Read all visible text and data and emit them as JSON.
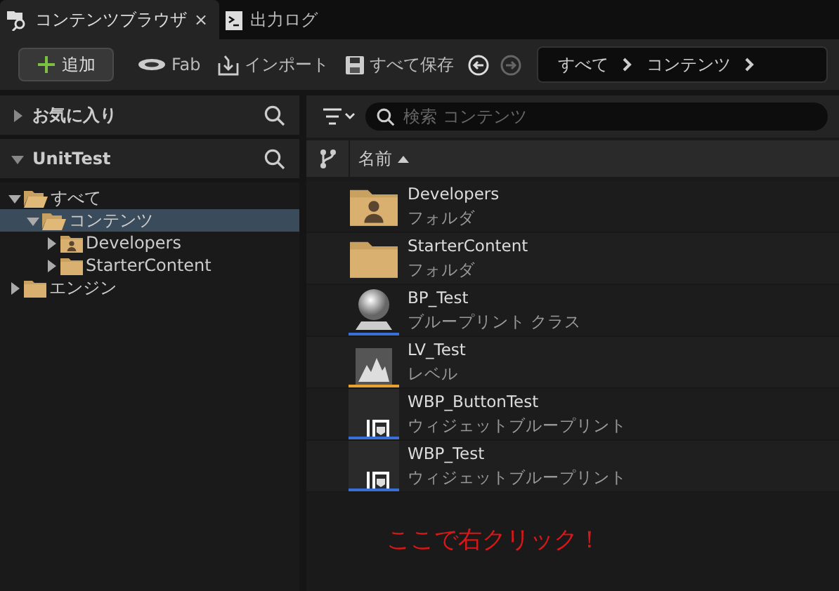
{
  "tabs": [
    {
      "label": "コンテンツブラウザ",
      "close": "×",
      "selected": true
    },
    {
      "label": "出力ログ",
      "selected": false
    }
  ],
  "toolbar": {
    "add": "追加",
    "buttons": [
      {
        "label": "Fab"
      },
      {
        "label": "インポート"
      },
      {
        "label": "すべて保存"
      }
    ],
    "nav": [
      {
        "disabled": false
      },
      {
        "disabled": true
      }
    ],
    "breadcrumbs": [
      "すべて",
      "コンテンツ"
    ]
  },
  "sidebar": {
    "sections": [
      {
        "title": "お気に入り",
        "expanded": false
      },
      {
        "title": "UnitTest",
        "expanded": true
      }
    ],
    "tree": [
      {
        "label": "すべて",
        "expanded": true,
        "selected": false,
        "kind": "folder",
        "children": [
          {
            "label": "コンテンツ",
            "expanded": true,
            "selected": true,
            "kind": "folder",
            "children": [
              {
                "label": "Developers",
                "expanded": false,
                "selected": false,
                "kind": "user-folder"
              },
              {
                "label": "StarterContent",
                "expanded": false,
                "selected": false,
                "kind": "folder"
              }
            ]
          }
        ]
      },
      {
        "label": "エンジン",
        "expanded": false,
        "selected": false,
        "kind": "folder"
      }
    ]
  },
  "search": {
    "placeholder": "検索 コンテンツ"
  },
  "columns": [
    {
      "label": "名前",
      "sorted": true
    }
  ],
  "assets": [
    {
      "name": "Developers",
      "type": "フォルダ",
      "kind": "user-folder"
    },
    {
      "name": "StarterContent",
      "type": "フォルダ",
      "kind": "folder"
    },
    {
      "name": "BP_Test",
      "type": "ブループリント クラス",
      "kind": "blueprint",
      "color": "#3a6fd8"
    },
    {
      "name": "LV_Test",
      "type": "レベル",
      "kind": "level",
      "color": "#e8a030"
    },
    {
      "name": "WBP_ButtonTest",
      "type": "ウィジェットブループリント",
      "kind": "widget",
      "color": "#3a6fd8"
    },
    {
      "name": "WBP_Test",
      "type": "ウィジェットブループリント",
      "kind": "widget",
      "color": "#3a6fd8"
    }
  ],
  "annotation": "ここで右クリック！"
}
